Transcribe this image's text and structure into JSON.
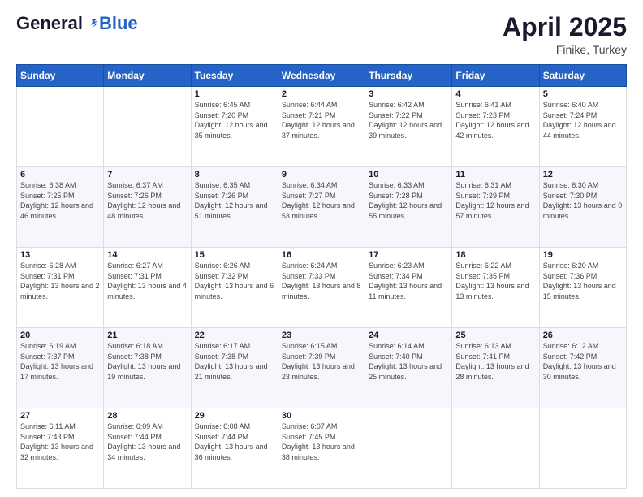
{
  "logo": {
    "general": "General",
    "blue": "Blue"
  },
  "header": {
    "month": "April 2025",
    "location": "Finike, Turkey"
  },
  "weekdays": [
    "Sunday",
    "Monday",
    "Tuesday",
    "Wednesday",
    "Thursday",
    "Friday",
    "Saturday"
  ],
  "weeks": [
    [
      {
        "day": "",
        "sunrise": "",
        "sunset": "",
        "daylight": ""
      },
      {
        "day": "",
        "sunrise": "",
        "sunset": "",
        "daylight": ""
      },
      {
        "day": "1",
        "sunrise": "Sunrise: 6:45 AM",
        "sunset": "Sunset: 7:20 PM",
        "daylight": "Daylight: 12 hours and 35 minutes."
      },
      {
        "day": "2",
        "sunrise": "Sunrise: 6:44 AM",
        "sunset": "Sunset: 7:21 PM",
        "daylight": "Daylight: 12 hours and 37 minutes."
      },
      {
        "day": "3",
        "sunrise": "Sunrise: 6:42 AM",
        "sunset": "Sunset: 7:22 PM",
        "daylight": "Daylight: 12 hours and 39 minutes."
      },
      {
        "day": "4",
        "sunrise": "Sunrise: 6:41 AM",
        "sunset": "Sunset: 7:23 PM",
        "daylight": "Daylight: 12 hours and 42 minutes."
      },
      {
        "day": "5",
        "sunrise": "Sunrise: 6:40 AM",
        "sunset": "Sunset: 7:24 PM",
        "daylight": "Daylight: 12 hours and 44 minutes."
      }
    ],
    [
      {
        "day": "6",
        "sunrise": "Sunrise: 6:38 AM",
        "sunset": "Sunset: 7:25 PM",
        "daylight": "Daylight: 12 hours and 46 minutes."
      },
      {
        "day": "7",
        "sunrise": "Sunrise: 6:37 AM",
        "sunset": "Sunset: 7:26 PM",
        "daylight": "Daylight: 12 hours and 48 minutes."
      },
      {
        "day": "8",
        "sunrise": "Sunrise: 6:35 AM",
        "sunset": "Sunset: 7:26 PM",
        "daylight": "Daylight: 12 hours and 51 minutes."
      },
      {
        "day": "9",
        "sunrise": "Sunrise: 6:34 AM",
        "sunset": "Sunset: 7:27 PM",
        "daylight": "Daylight: 12 hours and 53 minutes."
      },
      {
        "day": "10",
        "sunrise": "Sunrise: 6:33 AM",
        "sunset": "Sunset: 7:28 PM",
        "daylight": "Daylight: 12 hours and 55 minutes."
      },
      {
        "day": "11",
        "sunrise": "Sunrise: 6:31 AM",
        "sunset": "Sunset: 7:29 PM",
        "daylight": "Daylight: 12 hours and 57 minutes."
      },
      {
        "day": "12",
        "sunrise": "Sunrise: 6:30 AM",
        "sunset": "Sunset: 7:30 PM",
        "daylight": "Daylight: 13 hours and 0 minutes."
      }
    ],
    [
      {
        "day": "13",
        "sunrise": "Sunrise: 6:28 AM",
        "sunset": "Sunset: 7:31 PM",
        "daylight": "Daylight: 13 hours and 2 minutes."
      },
      {
        "day": "14",
        "sunrise": "Sunrise: 6:27 AM",
        "sunset": "Sunset: 7:31 PM",
        "daylight": "Daylight: 13 hours and 4 minutes."
      },
      {
        "day": "15",
        "sunrise": "Sunrise: 6:26 AM",
        "sunset": "Sunset: 7:32 PM",
        "daylight": "Daylight: 13 hours and 6 minutes."
      },
      {
        "day": "16",
        "sunrise": "Sunrise: 6:24 AM",
        "sunset": "Sunset: 7:33 PM",
        "daylight": "Daylight: 13 hours and 8 minutes."
      },
      {
        "day": "17",
        "sunrise": "Sunrise: 6:23 AM",
        "sunset": "Sunset: 7:34 PM",
        "daylight": "Daylight: 13 hours and 11 minutes."
      },
      {
        "day": "18",
        "sunrise": "Sunrise: 6:22 AM",
        "sunset": "Sunset: 7:35 PM",
        "daylight": "Daylight: 13 hours and 13 minutes."
      },
      {
        "day": "19",
        "sunrise": "Sunrise: 6:20 AM",
        "sunset": "Sunset: 7:36 PM",
        "daylight": "Daylight: 13 hours and 15 minutes."
      }
    ],
    [
      {
        "day": "20",
        "sunrise": "Sunrise: 6:19 AM",
        "sunset": "Sunset: 7:37 PM",
        "daylight": "Daylight: 13 hours and 17 minutes."
      },
      {
        "day": "21",
        "sunrise": "Sunrise: 6:18 AM",
        "sunset": "Sunset: 7:38 PM",
        "daylight": "Daylight: 13 hours and 19 minutes."
      },
      {
        "day": "22",
        "sunrise": "Sunrise: 6:17 AM",
        "sunset": "Sunset: 7:38 PM",
        "daylight": "Daylight: 13 hours and 21 minutes."
      },
      {
        "day": "23",
        "sunrise": "Sunrise: 6:15 AM",
        "sunset": "Sunset: 7:39 PM",
        "daylight": "Daylight: 13 hours and 23 minutes."
      },
      {
        "day": "24",
        "sunrise": "Sunrise: 6:14 AM",
        "sunset": "Sunset: 7:40 PM",
        "daylight": "Daylight: 13 hours and 25 minutes."
      },
      {
        "day": "25",
        "sunrise": "Sunrise: 6:13 AM",
        "sunset": "Sunset: 7:41 PM",
        "daylight": "Daylight: 13 hours and 28 minutes."
      },
      {
        "day": "26",
        "sunrise": "Sunrise: 6:12 AM",
        "sunset": "Sunset: 7:42 PM",
        "daylight": "Daylight: 13 hours and 30 minutes."
      }
    ],
    [
      {
        "day": "27",
        "sunrise": "Sunrise: 6:11 AM",
        "sunset": "Sunset: 7:43 PM",
        "daylight": "Daylight: 13 hours and 32 minutes."
      },
      {
        "day": "28",
        "sunrise": "Sunrise: 6:09 AM",
        "sunset": "Sunset: 7:44 PM",
        "daylight": "Daylight: 13 hours and 34 minutes."
      },
      {
        "day": "29",
        "sunrise": "Sunrise: 6:08 AM",
        "sunset": "Sunset: 7:44 PM",
        "daylight": "Daylight: 13 hours and 36 minutes."
      },
      {
        "day": "30",
        "sunrise": "Sunrise: 6:07 AM",
        "sunset": "Sunset: 7:45 PM",
        "daylight": "Daylight: 13 hours and 38 minutes."
      },
      {
        "day": "",
        "sunrise": "",
        "sunset": "",
        "daylight": ""
      },
      {
        "day": "",
        "sunrise": "",
        "sunset": "",
        "daylight": ""
      },
      {
        "day": "",
        "sunrise": "",
        "sunset": "",
        "daylight": ""
      }
    ]
  ]
}
